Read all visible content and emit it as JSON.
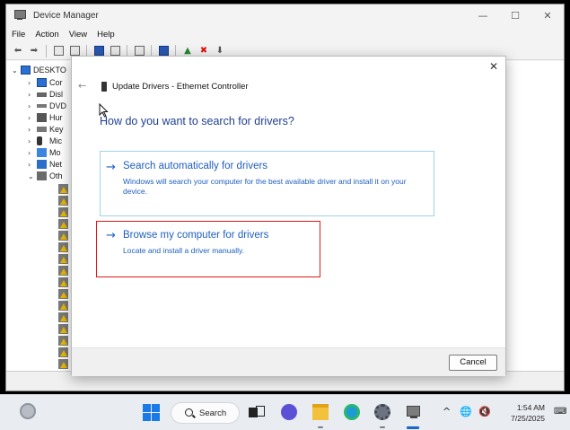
{
  "window": {
    "title": "Device Manager",
    "minimize_glyph": "—",
    "maximize_glyph": "☐",
    "close_glyph": "✕"
  },
  "menu": [
    "File",
    "Action",
    "View",
    "Help"
  ],
  "toolbar": {
    "back_glyph": "⬅",
    "forward_glyph": "➡",
    "remove_glyph": "✖",
    "update_glyph": "⬇"
  },
  "tree": {
    "root": "DESKTO",
    "categories": [
      {
        "label": "Cor",
        "icon": "computer-icon"
      },
      {
        "label": "Disl",
        "icon": "disk-drive-icon"
      },
      {
        "label": "DVD",
        "icon": "dvd-drive-icon"
      },
      {
        "label": "Hur",
        "icon": "hid-icon"
      },
      {
        "label": "Key",
        "icon": "keyboard-icon"
      },
      {
        "label": "Mic",
        "icon": "microphone-icon"
      },
      {
        "label": "Mo",
        "icon": "monitor-icon"
      },
      {
        "label": "Net",
        "icon": "network-adapter-icon"
      },
      {
        "label": "Oth",
        "icon": "other-devices-icon"
      }
    ],
    "unknown_device_count": 16
  },
  "dialog": {
    "title": "Update Drivers - Ethernet Controller",
    "heading": "How do you want to search for drivers?",
    "close_glyph": "✕",
    "back_glyph": "←",
    "options": [
      {
        "arrow": "→",
        "title": "Search automatically for drivers",
        "description": "Windows will search your computer for the best available driver and install it on your device."
      },
      {
        "arrow": "→",
        "title": "Browse my computer for drivers",
        "description": "Locate and install a driver manually."
      }
    ],
    "cancel_label": "Cancel",
    "highlight_color": "#e01a1a"
  },
  "taskbar": {
    "search_label": "Search",
    "tray_glyphs": {
      "chevron": "^",
      "network": "🌐",
      "volume": "🔇"
    },
    "time": "1:54 AM",
    "date": "7/25/2025",
    "notification_glyph": "⌨"
  }
}
